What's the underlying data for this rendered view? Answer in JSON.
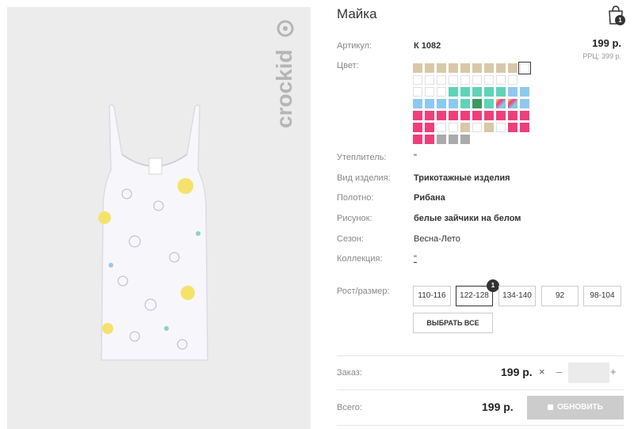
{
  "brand": {
    "name": "crockid"
  },
  "product": {
    "title": "Майка"
  },
  "cart": {
    "count": "1"
  },
  "details": {
    "article_label": "Артикул:",
    "article_value": "К 1082",
    "price": "199 р.",
    "rrc": "РРЦ: 399 р.",
    "color_label": "Цвет:",
    "insulation_label": "Утеплитель:",
    "insulation_value": "\"",
    "type_label": "Вид изделия:",
    "type_value": "Трикотажные изделия",
    "fabric_label": "Полотно:",
    "fabric_value": "Рибана",
    "print_label": "Рисунок:",
    "print_value": "белые зайчики на белом",
    "season_label": "Сезон:",
    "season_value": "Весна-Лето",
    "collection_label": "Коллекция:",
    "collection_value": "\"",
    "size_label": "Рост/размер:"
  },
  "swatches": [
    [
      "#d8c8a8",
      "#d8c8a8",
      "#d8c8a8",
      "#d8c8a8",
      "#d8c8a8",
      "#d8c8a8",
      "#d8c8a8",
      "#d8c8a8",
      "#d8c8a8",
      "selected"
    ],
    [
      "empty",
      "empty",
      "empty",
      "empty",
      "empty",
      "empty",
      "empty",
      "empty",
      "empty"
    ],
    [
      "empty",
      "empty",
      "empty",
      "#5fd3b8",
      "#5fd3b8",
      "#5fd3b8",
      "#5fd3b8",
      "#5fd3b8",
      "#8ec8f0",
      "#8ec8f0"
    ],
    [
      "#8ec8f0",
      "#8ec8f0",
      "#8ec8f0",
      "#8ec8f0",
      "#5fd3b8",
      "#3a9a5c",
      "#5fd3b8",
      "rainbow",
      "rainbow",
      "#8ec8f0"
    ],
    [
      "#ee3f7a",
      "#ee3f7a",
      "#ee3f7a",
      "#ee3f7a",
      "#ee3f7a",
      "#ee3f7a",
      "#ee3f7a",
      "#ee3f7a",
      "#ee3f7a",
      "#ee3f7a"
    ],
    [
      "#ee3f7a",
      "#ee3f7a",
      "empty",
      "empty",
      "#d8c8a8",
      "empty",
      "#d8c8a8",
      "empty",
      "#ee3f7a",
      "#ee3f7a"
    ],
    [
      "#ee3f7a",
      "#ee3f7a",
      "#aaaaaa",
      "#aaaaaa",
      "#aaaaaa"
    ]
  ],
  "sizes": [
    {
      "label": "110-116",
      "active": false
    },
    {
      "label": "122-128",
      "active": true,
      "badge": "1"
    },
    {
      "label": "134-140",
      "active": false
    },
    {
      "label": "92",
      "active": false
    },
    {
      "label": "98-104",
      "active": false
    }
  ],
  "select_all": "ВЫБРАТЬ ВСЕ",
  "order": {
    "label": "Заказ:",
    "price": "199 р.",
    "times": "×",
    "minus": "–",
    "plus": "+",
    "qty": ""
  },
  "total": {
    "label": "Всего:",
    "price": "199 р.",
    "button": "ОБНОВИТЬ"
  }
}
